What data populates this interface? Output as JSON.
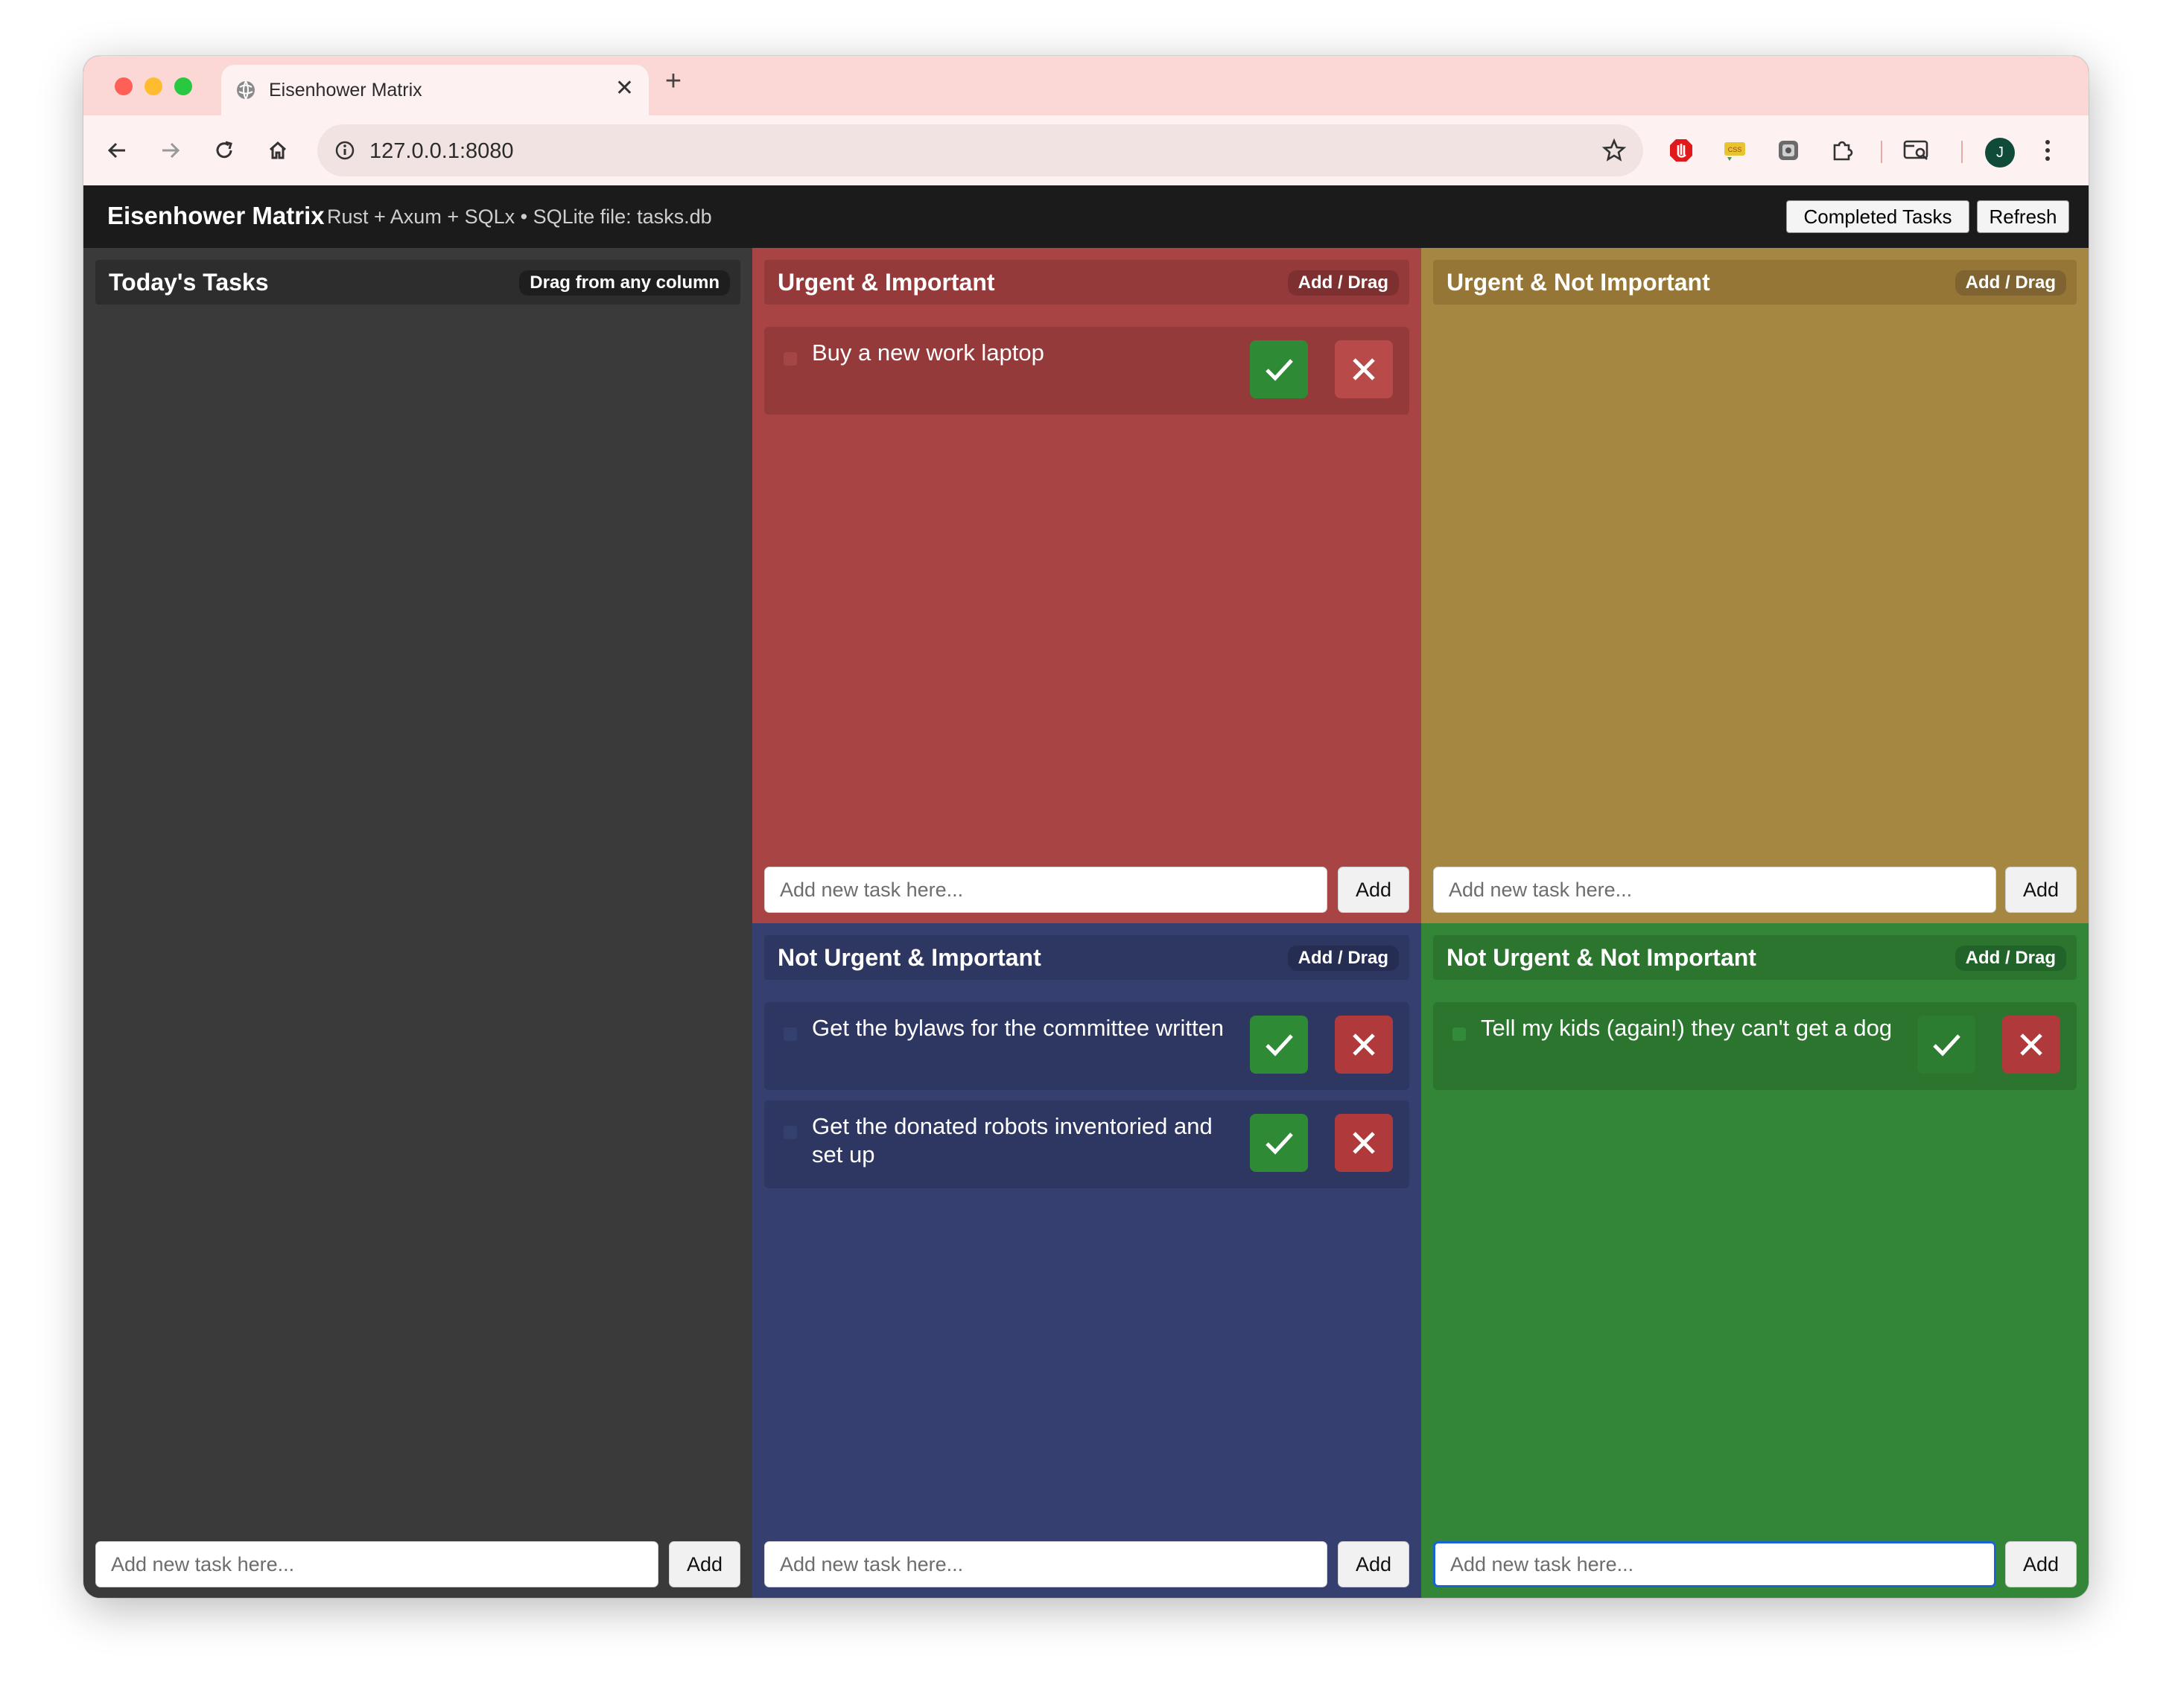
{
  "browser": {
    "tab_title": "Eisenhower Matrix",
    "url": "127.0.0.1:8080",
    "avatar_initial": "J",
    "icons": [
      "back-icon",
      "forward-icon",
      "reload-icon",
      "home-icon",
      "site-info-icon",
      "bookmark-star-icon",
      "adblock-extension-icon",
      "css-extension-icon",
      "extension-icon",
      "puzzle-extensions-icon",
      "tab-search-icon",
      "kebab-menu-icon"
    ]
  },
  "app": {
    "title": "Eisenhower Matrix",
    "subtitle": "Rust + Axum + SQLx • SQLite file: tasks.db",
    "completed_label": "Completed Tasks",
    "refresh_label": "Refresh"
  },
  "placeholder": "Add new task here...",
  "add_label": "Add",
  "columns": {
    "today": {
      "title": "Today's Tasks",
      "badge": "Drag from any column",
      "color": "#3a3a3a",
      "head_color": "#2d2d2d"
    },
    "ui": {
      "title": "Urgent & Important",
      "badge": "Add / Drag",
      "color": "#a84443",
      "head_color": "#953a3a",
      "tasks": [
        {
          "text": "Buy a new work laptop"
        }
      ]
    },
    "uni": {
      "title": "Urgent & Not Important",
      "badge": "Add / Drag",
      "color": "#a68742",
      "head_color": "#967637",
      "tasks": []
    },
    "nui": {
      "title": "Not Urgent & Important",
      "badge": "Add / Drag",
      "color": "#364070",
      "head_color": "#2e3762",
      "tasks": [
        {
          "text": "Get the bylaws for the committee written"
        },
        {
          "text": "Get the donated robots inventoried and set up"
        }
      ]
    },
    "nuni": {
      "title": "Not Urgent & Not Important",
      "badge": "Add / Drag",
      "color": "#338637",
      "head_color": "#2c752f",
      "tasks": [
        {
          "text": "Tell my kids (again!) they can't get a dog"
        }
      ]
    }
  }
}
